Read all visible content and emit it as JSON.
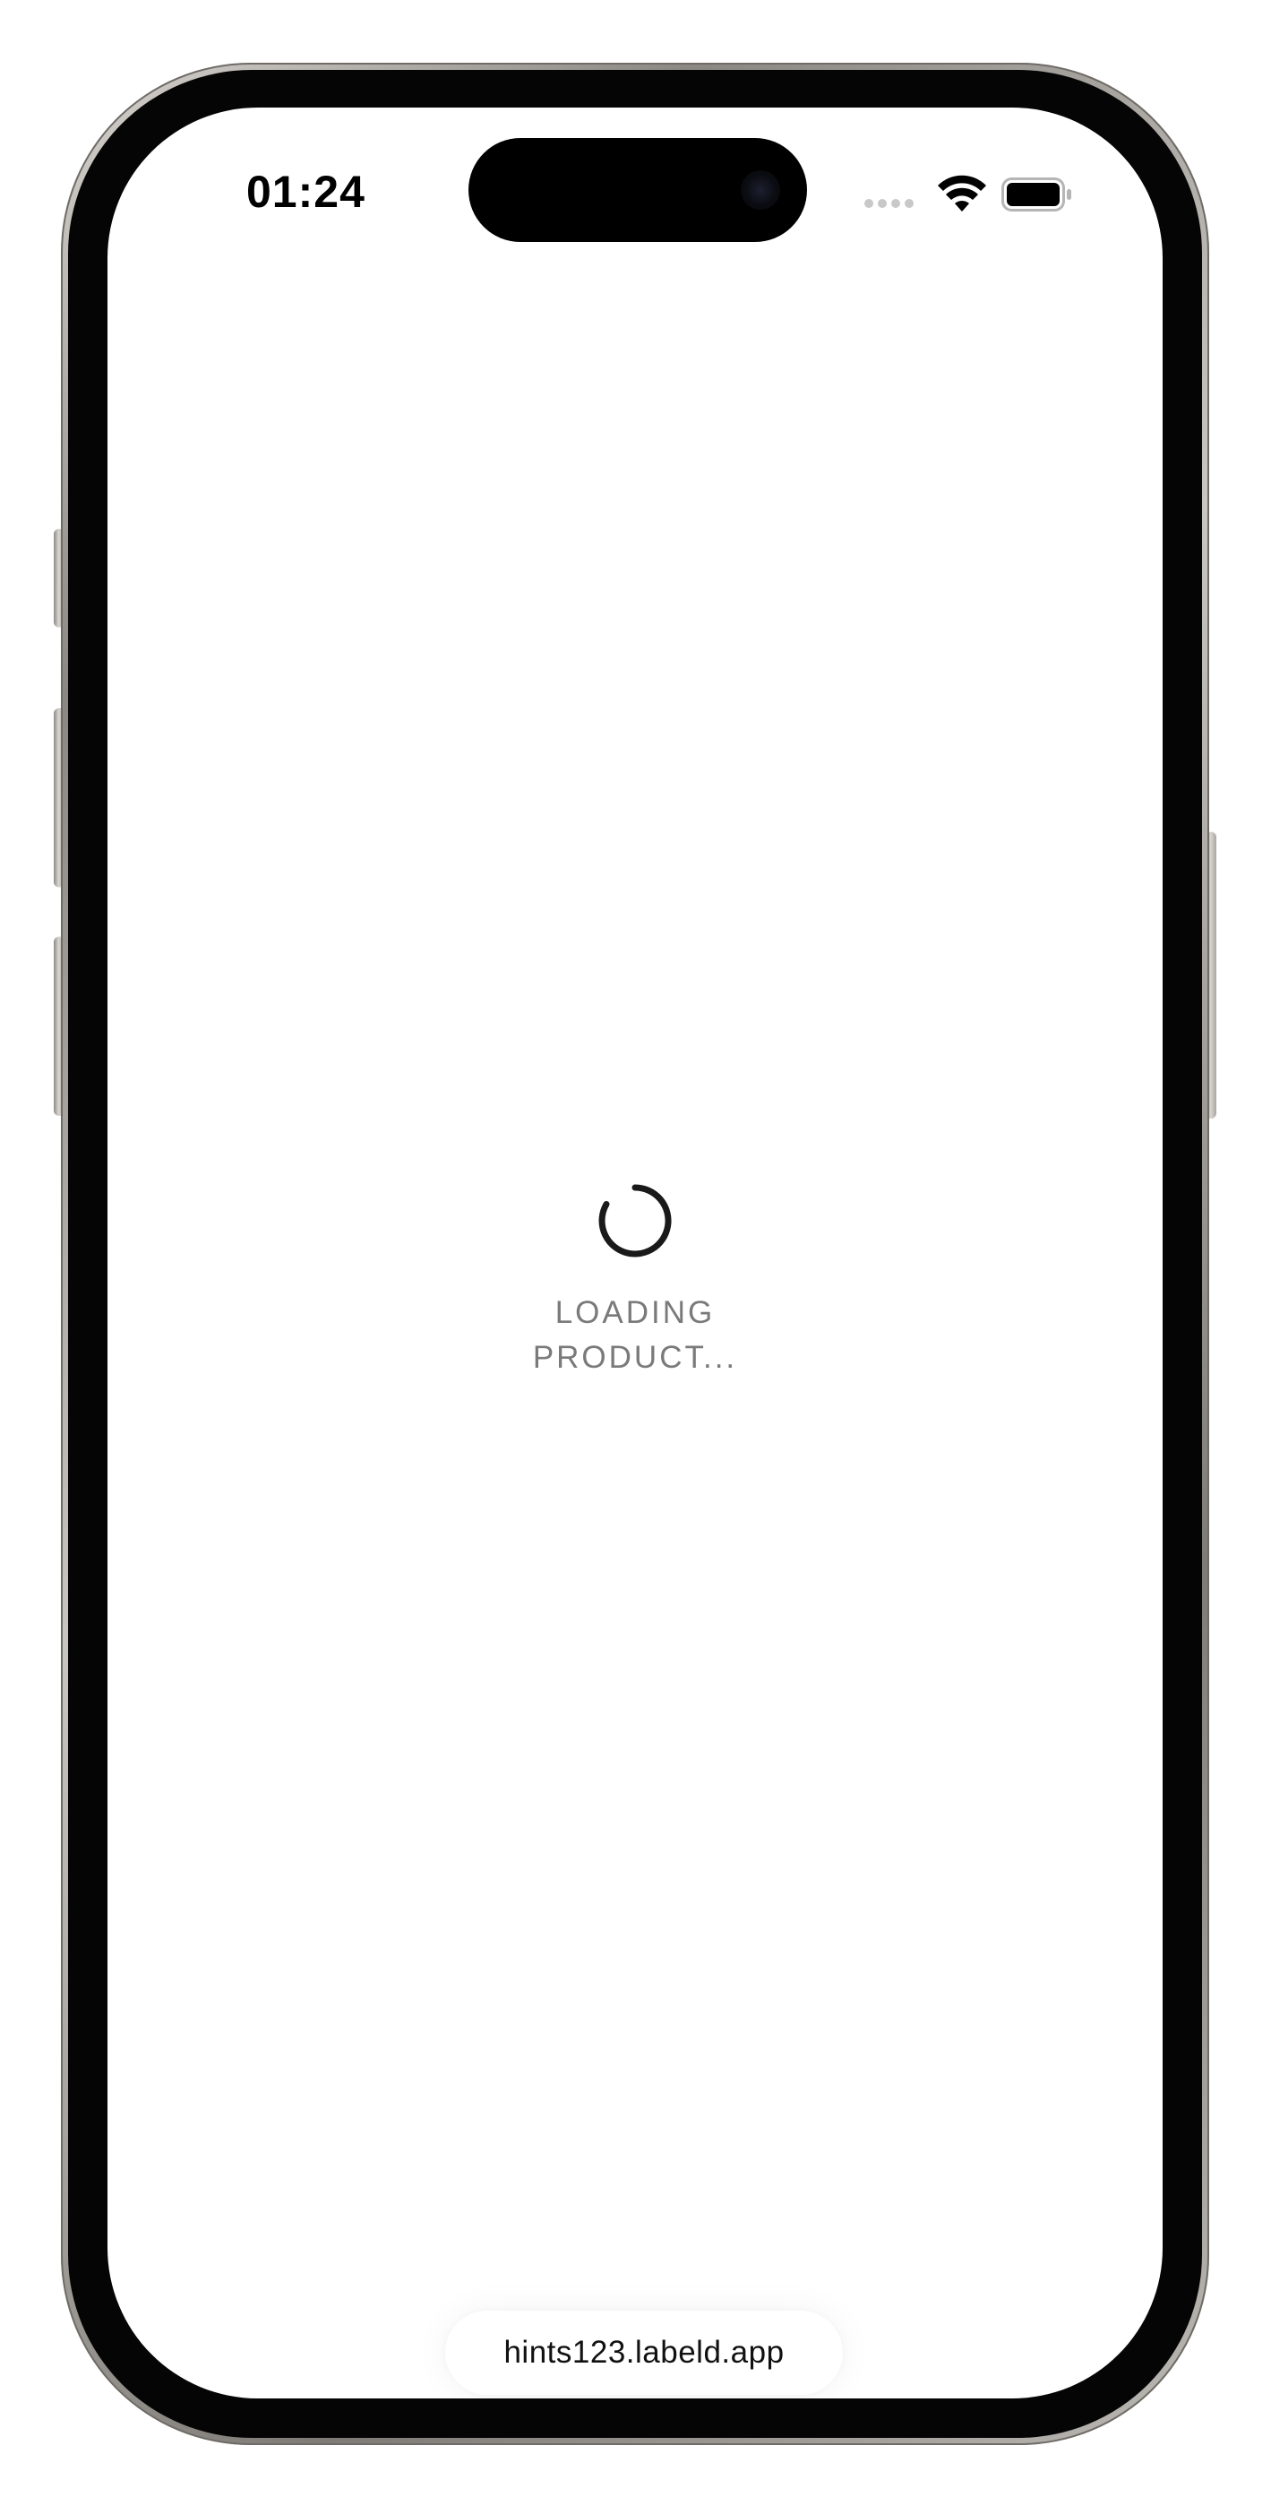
{
  "status_bar": {
    "time": "01:24",
    "icons": [
      "signal-icon",
      "wifi-icon",
      "battery-icon"
    ]
  },
  "main": {
    "loading_icon": "spinner-icon",
    "loading_text": "LOADING PRODUCT..."
  },
  "browser": {
    "url": "hints123.labeld.app"
  },
  "colors": {
    "background": "#ffffff",
    "text_primary": "#000000",
    "text_muted": "#7a7a7a",
    "spinner": "#1a1a1a"
  }
}
